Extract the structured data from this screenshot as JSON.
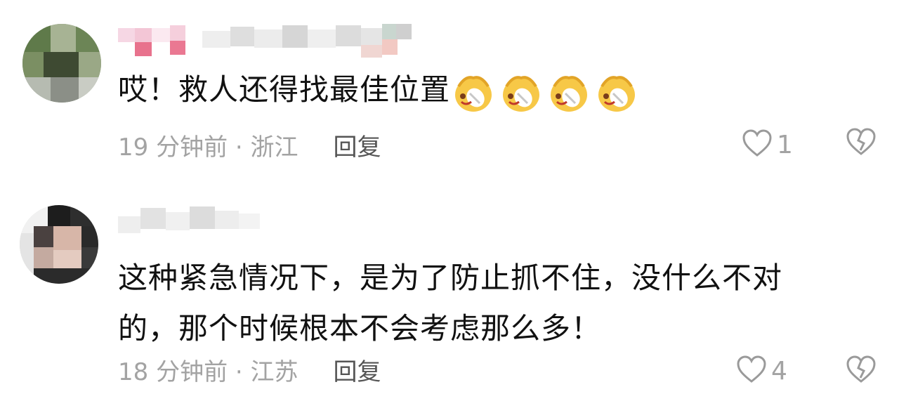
{
  "comments": [
    {
      "username": "",
      "text": "哎！救人还得找最佳位置",
      "emoji": "sweat-smile-crying-emoji",
      "emoji_count": 4,
      "time": "19 分钟前",
      "location": "浙江",
      "reply_label": "回复",
      "likes": "1"
    },
    {
      "username": "",
      "text_line1": "这种紧急情况下，是为了防止抓不住，没什么不对",
      "text_line2": "的，那个时候根本不会考虑那么多！",
      "time": "18 分钟前",
      "location": "江苏",
      "reply_label": "回复",
      "likes": "4"
    }
  ],
  "separator": " · ",
  "icons": {
    "like": "heart-outline-icon",
    "dislike": "broken-heart-icon"
  },
  "colors": {
    "meta_text": "#a3a3a3",
    "reply_text": "#555555",
    "body_text": "#111111"
  }
}
